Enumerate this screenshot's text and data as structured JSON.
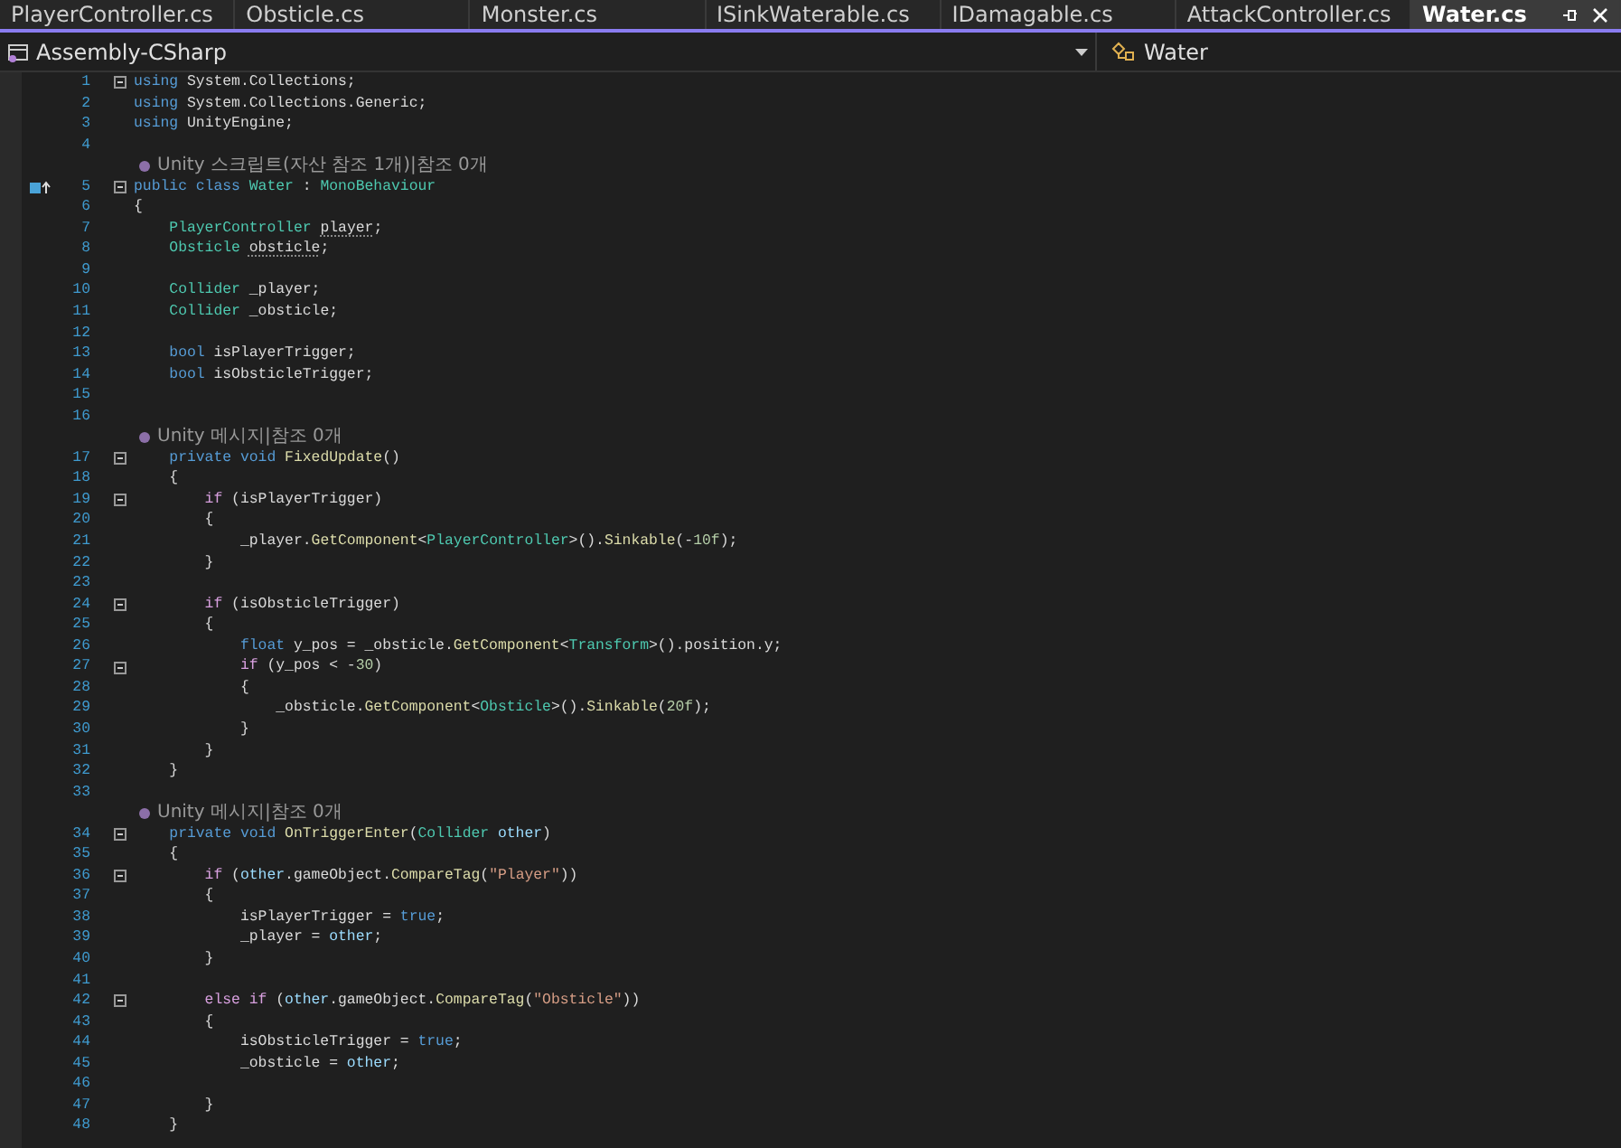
{
  "tabs": [
    {
      "label": "PlayerController.cs",
      "selected": false
    },
    {
      "label": "Obsticle.cs",
      "selected": false
    },
    {
      "label": "Monster.cs",
      "selected": false
    },
    {
      "label": "ISinkWaterable.cs",
      "selected": false
    },
    {
      "label": "IDamagable.cs",
      "selected": false
    },
    {
      "label": "AttackController.cs",
      "selected": false
    },
    {
      "label": "Water.cs",
      "selected": true
    }
  ],
  "navigation": {
    "project": "Assembly-CSharp",
    "member": "Water"
  },
  "editor": {
    "lines": [
      {
        "kind": "code",
        "number": "1",
        "fold": true,
        "tokens": [
          {
            "kind": "keyword",
            "text": "using"
          },
          {
            "kind": "plain",
            "text": " System.Collections;"
          }
        ]
      },
      {
        "kind": "code",
        "number": "2",
        "tokens": [
          {
            "kind": "keyword",
            "text": "using"
          },
          {
            "kind": "plain",
            "text": " System.Collections.Generic;"
          }
        ]
      },
      {
        "kind": "code",
        "number": "3",
        "tokens": [
          {
            "kind": "keyword",
            "text": "using"
          },
          {
            "kind": "plain",
            "text": " UnityEngine;"
          }
        ]
      },
      {
        "kind": "code",
        "number": "4"
      },
      {
        "kind": "lens",
        "text": "Unity 스크립트(자산 참조 1개)|참조 0개"
      },
      {
        "kind": "code",
        "number": "5",
        "fold": true,
        "margin_icon": true,
        "tokens": [
          {
            "kind": "keyword",
            "text": "public class"
          },
          {
            "kind": "type",
            "text": " Water"
          },
          {
            "kind": "plain",
            "text": " :"
          },
          {
            "kind": "type",
            "text": " MonoBehaviour"
          }
        ]
      },
      {
        "kind": "code",
        "number": "6",
        "tokens": [
          {
            "kind": "plain",
            "text": "{"
          }
        ]
      },
      {
        "kind": "code",
        "number": "7",
        "tokens": [
          {
            "kind": "type",
            "text": "    PlayerController"
          },
          {
            "kind": "plain",
            "text": " player",
            "dotted": true
          },
          {
            "kind": "plain",
            "text": ";"
          }
        ]
      },
      {
        "kind": "code",
        "number": "8",
        "tokens": [
          {
            "kind": "type",
            "text": "    Obsticle"
          },
          {
            "kind": "plain",
            "text": " obsticle",
            "dotted": true
          },
          {
            "kind": "plain",
            "text": ";"
          }
        ]
      },
      {
        "kind": "code",
        "number": "9"
      },
      {
        "kind": "code",
        "number": "10",
        "tokens": [
          {
            "kind": "type",
            "text": "    Collider"
          },
          {
            "kind": "plain",
            "text": " _player;"
          }
        ]
      },
      {
        "kind": "code",
        "number": "11",
        "tokens": [
          {
            "kind": "type",
            "text": "    Collider"
          },
          {
            "kind": "plain",
            "text": " _obsticle;"
          }
        ]
      },
      {
        "kind": "code",
        "number": "12"
      },
      {
        "kind": "code",
        "number": "13",
        "tokens": [
          {
            "kind": "keyword",
            "text": "    bool"
          },
          {
            "kind": "plain",
            "text": " isPlayerTrigger;"
          }
        ]
      },
      {
        "kind": "code",
        "number": "14",
        "tokens": [
          {
            "kind": "keyword",
            "text": "    bool"
          },
          {
            "kind": "plain",
            "text": " isObsticleTrigger;"
          }
        ]
      },
      {
        "kind": "code",
        "number": "15"
      },
      {
        "kind": "code",
        "number": "16"
      },
      {
        "kind": "lens",
        "text": "Unity 메시지|참조 0개"
      },
      {
        "kind": "code",
        "number": "17",
        "fold": true,
        "tokens": [
          {
            "kind": "keyword",
            "text": "    private void"
          },
          {
            "kind": "method",
            "text": " FixedUpdate"
          },
          {
            "kind": "plain",
            "text": "()"
          }
        ]
      },
      {
        "kind": "code",
        "number": "18",
        "tokens": [
          {
            "kind": "plain",
            "text": "    {"
          }
        ]
      },
      {
        "kind": "code",
        "number": "19",
        "fold": true,
        "tokens": [
          {
            "kind": "control",
            "text": "        if"
          },
          {
            "kind": "plain",
            "text": " (isPlayerTrigger)"
          }
        ]
      },
      {
        "kind": "code",
        "number": "20",
        "tokens": [
          {
            "kind": "plain",
            "text": "        {"
          }
        ]
      },
      {
        "kind": "code",
        "number": "21",
        "tokens": [
          {
            "kind": "plain",
            "text": "            _player."
          },
          {
            "kind": "method",
            "text": "GetComponent"
          },
          {
            "kind": "plain",
            "text": "<"
          },
          {
            "kind": "type",
            "text": "PlayerController"
          },
          {
            "kind": "plain",
            "text": ">()."
          },
          {
            "kind": "method",
            "text": "Sinkable"
          },
          {
            "kind": "plain",
            "text": "(-"
          },
          {
            "kind": "number",
            "text": "10f"
          },
          {
            "kind": "plain",
            "text": ");"
          }
        ]
      },
      {
        "kind": "code",
        "number": "22",
        "tokens": [
          {
            "kind": "plain",
            "text": "        }"
          }
        ]
      },
      {
        "kind": "code",
        "number": "23"
      },
      {
        "kind": "code",
        "number": "24",
        "fold": true,
        "tokens": [
          {
            "kind": "control",
            "text": "        if"
          },
          {
            "kind": "plain",
            "text": " (isObsticleTrigger)"
          }
        ]
      },
      {
        "kind": "code",
        "number": "25",
        "tokens": [
          {
            "kind": "plain",
            "text": "        {"
          }
        ]
      },
      {
        "kind": "code",
        "number": "26",
        "tokens": [
          {
            "kind": "keyword",
            "text": "            float"
          },
          {
            "kind": "plain",
            "text": " y_pos = _obsticle."
          },
          {
            "kind": "method",
            "text": "GetComponent"
          },
          {
            "kind": "plain",
            "text": "<"
          },
          {
            "kind": "type",
            "text": "Transform"
          },
          {
            "kind": "plain",
            "text": ">().position.y;"
          }
        ]
      },
      {
        "kind": "code",
        "number": "27",
        "fold": true,
        "tokens": [
          {
            "kind": "control",
            "text": "            if"
          },
          {
            "kind": "plain",
            "text": " (y_pos < -"
          },
          {
            "kind": "number",
            "text": "30"
          },
          {
            "kind": "plain",
            "text": ")"
          }
        ]
      },
      {
        "kind": "code",
        "number": "28",
        "tokens": [
          {
            "kind": "plain",
            "text": "            {"
          }
        ]
      },
      {
        "kind": "code",
        "number": "29",
        "tokens": [
          {
            "kind": "plain",
            "text": "                _obsticle."
          },
          {
            "kind": "method",
            "text": "GetComponent"
          },
          {
            "kind": "plain",
            "text": "<"
          },
          {
            "kind": "type",
            "text": "Obsticle"
          },
          {
            "kind": "plain",
            "text": ">()."
          },
          {
            "kind": "method",
            "text": "Sinkable"
          },
          {
            "kind": "plain",
            "text": "("
          },
          {
            "kind": "number",
            "text": "20f"
          },
          {
            "kind": "plain",
            "text": ");"
          }
        ]
      },
      {
        "kind": "code",
        "number": "30",
        "tokens": [
          {
            "kind": "plain",
            "text": "            }"
          }
        ]
      },
      {
        "kind": "code",
        "number": "31",
        "tokens": [
          {
            "kind": "plain",
            "text": "        }"
          }
        ]
      },
      {
        "kind": "code",
        "number": "32",
        "tokens": [
          {
            "kind": "plain",
            "text": "    }"
          }
        ]
      },
      {
        "kind": "code",
        "number": "33"
      },
      {
        "kind": "lens",
        "text": "Unity 메시지|참조 0개"
      },
      {
        "kind": "code",
        "number": "34",
        "fold": true,
        "tokens": [
          {
            "kind": "keyword",
            "text": "    private void"
          },
          {
            "kind": "method",
            "text": " OnTriggerEnter"
          },
          {
            "kind": "plain",
            "text": "("
          },
          {
            "kind": "type",
            "text": "Collider"
          },
          {
            "kind": "parameter",
            "text": " other"
          },
          {
            "kind": "plain",
            "text": ")"
          }
        ]
      },
      {
        "kind": "code",
        "number": "35",
        "tokens": [
          {
            "kind": "plain",
            "text": "    {"
          }
        ]
      },
      {
        "kind": "code",
        "number": "36",
        "fold": true,
        "tokens": [
          {
            "kind": "control",
            "text": "        if"
          },
          {
            "kind": "plain",
            "text": " ("
          },
          {
            "kind": "parameter",
            "text": "other"
          },
          {
            "kind": "plain",
            "text": ".gameObject."
          },
          {
            "kind": "method",
            "text": "CompareTag"
          },
          {
            "kind": "plain",
            "text": "("
          },
          {
            "kind": "string",
            "text": "\"Player\""
          },
          {
            "kind": "plain",
            "text": "))"
          }
        ]
      },
      {
        "kind": "code",
        "number": "37",
        "tokens": [
          {
            "kind": "plain",
            "text": "        {"
          }
        ]
      },
      {
        "kind": "code",
        "number": "38",
        "tokens": [
          {
            "kind": "plain",
            "text": "            isPlayerTrigger ="
          },
          {
            "kind": "keyword",
            "text": " true"
          },
          {
            "kind": "plain",
            "text": ";"
          }
        ]
      },
      {
        "kind": "code",
        "number": "39",
        "tokens": [
          {
            "kind": "plain",
            "text": "            _player ="
          },
          {
            "kind": "parameter",
            "text": " other"
          },
          {
            "kind": "plain",
            "text": ";"
          }
        ]
      },
      {
        "kind": "code",
        "number": "40",
        "tokens": [
          {
            "kind": "plain",
            "text": "        }"
          }
        ]
      },
      {
        "kind": "code",
        "number": "41"
      },
      {
        "kind": "code",
        "number": "42",
        "fold": true,
        "tokens": [
          {
            "kind": "control",
            "text": "        else if"
          },
          {
            "kind": "plain",
            "text": " ("
          },
          {
            "kind": "parameter",
            "text": "other"
          },
          {
            "kind": "plain",
            "text": ".gameObject."
          },
          {
            "kind": "method",
            "text": "CompareTag"
          },
          {
            "kind": "plain",
            "text": "("
          },
          {
            "kind": "string",
            "text": "\"Obsticle\""
          },
          {
            "kind": "plain",
            "text": "))"
          }
        ]
      },
      {
        "kind": "code",
        "number": "43",
        "tokens": [
          {
            "kind": "plain",
            "text": "        {"
          }
        ]
      },
      {
        "kind": "code",
        "number": "44",
        "tokens": [
          {
            "kind": "plain",
            "text": "            isObsticleTrigger ="
          },
          {
            "kind": "keyword",
            "text": " true"
          },
          {
            "kind": "plain",
            "text": ";"
          }
        ]
      },
      {
        "kind": "code",
        "number": "45",
        "tokens": [
          {
            "kind": "plain",
            "text": "            _obsticle ="
          },
          {
            "kind": "parameter",
            "text": " other"
          },
          {
            "kind": "plain",
            "text": ";"
          }
        ]
      },
      {
        "kind": "code",
        "number": "46"
      },
      {
        "kind": "code",
        "number": "47",
        "tokens": [
          {
            "kind": "plain",
            "text": "        }"
          }
        ]
      },
      {
        "kind": "code",
        "number": "48",
        "tokens": [
          {
            "kind": "plain",
            "text": "    }"
          }
        ]
      }
    ]
  }
}
